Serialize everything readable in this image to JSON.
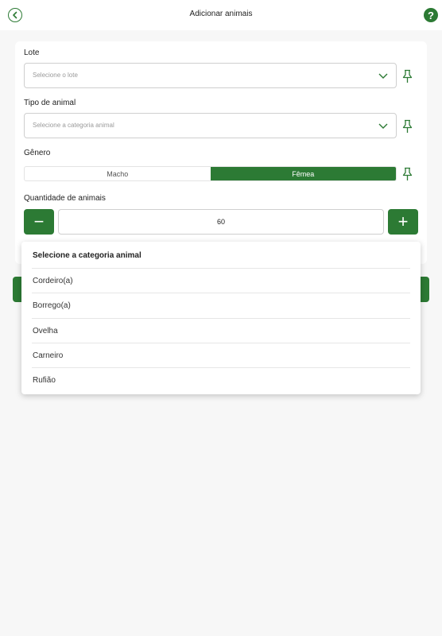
{
  "header": {
    "title": "Adicionar animais",
    "back_icon": "chevron-left-circle-icon",
    "help_icon": "question-circle-icon",
    "help_glyph": "?"
  },
  "form": {
    "lote": {
      "label": "Lote",
      "placeholder": "Selecione o lote"
    },
    "tipo": {
      "label": "Tipo de animal",
      "placeholder": "Selecione a categoria animal"
    },
    "genero": {
      "label": "Gênero",
      "options": [
        "Macho",
        "Fêmea"
      ],
      "selected": "Fêmea"
    },
    "quantidade": {
      "label": "Quantidade de animais",
      "value": "60",
      "minus": "−",
      "plus": "+"
    }
  },
  "dropdown": {
    "header": "Selecione a categoria animal",
    "items": [
      "Cordeiro(a)",
      "Borrego(a)",
      "Ovelha",
      "Carneiro",
      "Rufião"
    ]
  },
  "colors": {
    "accent": "#2c7a34",
    "background": "#f7f7f7"
  }
}
